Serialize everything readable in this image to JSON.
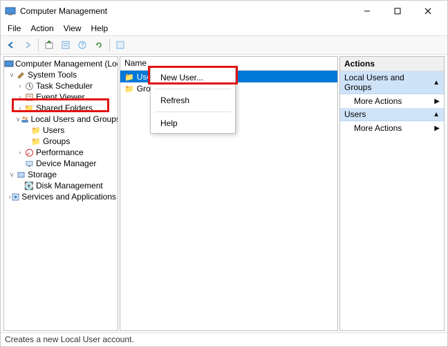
{
  "window": {
    "title": "Computer Management"
  },
  "menu": {
    "file": "File",
    "action": "Action",
    "view": "View",
    "help": "Help"
  },
  "tree": {
    "root": "Computer Management (Local)",
    "system_tools": "System Tools",
    "task_scheduler": "Task Scheduler",
    "event_viewer": "Event Viewer",
    "shared_folders": "Shared Folders",
    "local_users_groups": "Local Users and Groups",
    "users": "Users",
    "groups": "Groups",
    "performance": "Performance",
    "device_manager": "Device Manager",
    "storage": "Storage",
    "disk_management": "Disk Management",
    "services_apps": "Services and Applications"
  },
  "list": {
    "header_name": "Name",
    "users": "Users",
    "groups": "Groups"
  },
  "context": {
    "new_user": "New User...",
    "refresh": "Refresh",
    "help": "Help"
  },
  "actions": {
    "title": "Actions",
    "group1": "Local Users and Groups",
    "more1": "More Actions",
    "group2": "Users",
    "more2": "More Actions"
  },
  "status": {
    "text": "Creates a new Local User account."
  }
}
